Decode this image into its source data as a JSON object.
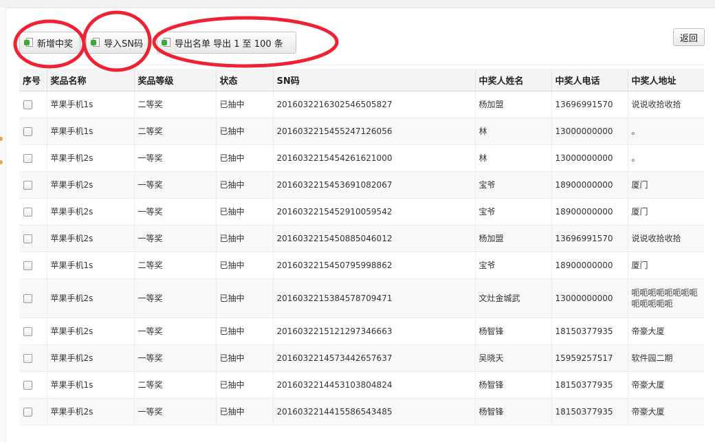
{
  "toolbar": {
    "add_label": "新增中奖",
    "import_label": "导入SN码",
    "export_label": "导出名单 导出 1 至 100 条",
    "back_label": "返回"
  },
  "table": {
    "headers": [
      "序号",
      "奖品名称",
      "奖品等级",
      "状态",
      "SN码",
      "中奖人姓名",
      "中奖人电话",
      "中奖人地址"
    ],
    "rows": [
      {
        "prize": "苹果手机1s",
        "level": "二等奖",
        "status": "已抽中",
        "sn": "2016032216302546505827",
        "name": "杨加盟",
        "phone": "13696991570",
        "address": "说说收拾收拾"
      },
      {
        "prize": "苹果手机1s",
        "level": "二等奖",
        "status": "已抽中",
        "sn": "2016032215455247126056",
        "name": "林",
        "phone": "13000000000",
        "address": "。"
      },
      {
        "prize": "苹果手机2s",
        "level": "一等奖",
        "status": "已抽中",
        "sn": "2016032215454261621000",
        "name": "林",
        "phone": "13000000000",
        "address": "。"
      },
      {
        "prize": "苹果手机2s",
        "level": "一等奖",
        "status": "已抽中",
        "sn": "2016032215453691082067",
        "name": "宝爷",
        "phone": "18900000000",
        "address": "厦门"
      },
      {
        "prize": "苹果手机2s",
        "level": "一等奖",
        "status": "已抽中",
        "sn": "2016032215452910059542",
        "name": "宝爷",
        "phone": "18900000000",
        "address": "厦门"
      },
      {
        "prize": "苹果手机2s",
        "level": "一等奖",
        "status": "已抽中",
        "sn": "2016032215450885046012",
        "name": "杨加盟",
        "phone": "13696991570",
        "address": "说说收拾收拾"
      },
      {
        "prize": "苹果手机1s",
        "level": "二等奖",
        "status": "已抽中",
        "sn": "2016032215450795998862",
        "name": "宝爷",
        "phone": "18900000000",
        "address": "厦门"
      },
      {
        "prize": "苹果手机2s",
        "level": "一等奖",
        "status": "已抽中",
        "sn": "2016032215384578709471",
        "name": "文灶金城武",
        "phone": "13000000000",
        "address": "呃呃呃呃呃呃呃呃呃呃呃呃呃"
      },
      {
        "prize": "苹果手机2s",
        "level": "一等奖",
        "status": "已抽中",
        "sn": "2016032215121297346663",
        "name": "杨智锋",
        "phone": "18150377935",
        "address": "帝豪大厦"
      },
      {
        "prize": "苹果手机2s",
        "level": "一等奖",
        "status": "已抽中",
        "sn": "2016032214573442657637",
        "name": "吴晓天",
        "phone": "15959257517",
        "address": "软件园二期"
      },
      {
        "prize": "苹果手机1s",
        "level": "二等奖",
        "status": "已抽中",
        "sn": "2016032214453103804824",
        "name": "杨智锋",
        "phone": "18150377935",
        "address": "帝豪大厦"
      },
      {
        "prize": "苹果手机2s",
        "level": "一等奖",
        "status": "已抽中",
        "sn": "2016032214415586543485",
        "name": "杨智锋",
        "phone": "18150377935",
        "address": "帝豪大厦"
      }
    ]
  },
  "colors": {
    "annotation_red": "#ee2233",
    "icon_green": "#3aa83a",
    "rail_orange": "#f0a44a"
  },
  "icons": {
    "toolbar_button_icon": "excel-export-icon"
  }
}
